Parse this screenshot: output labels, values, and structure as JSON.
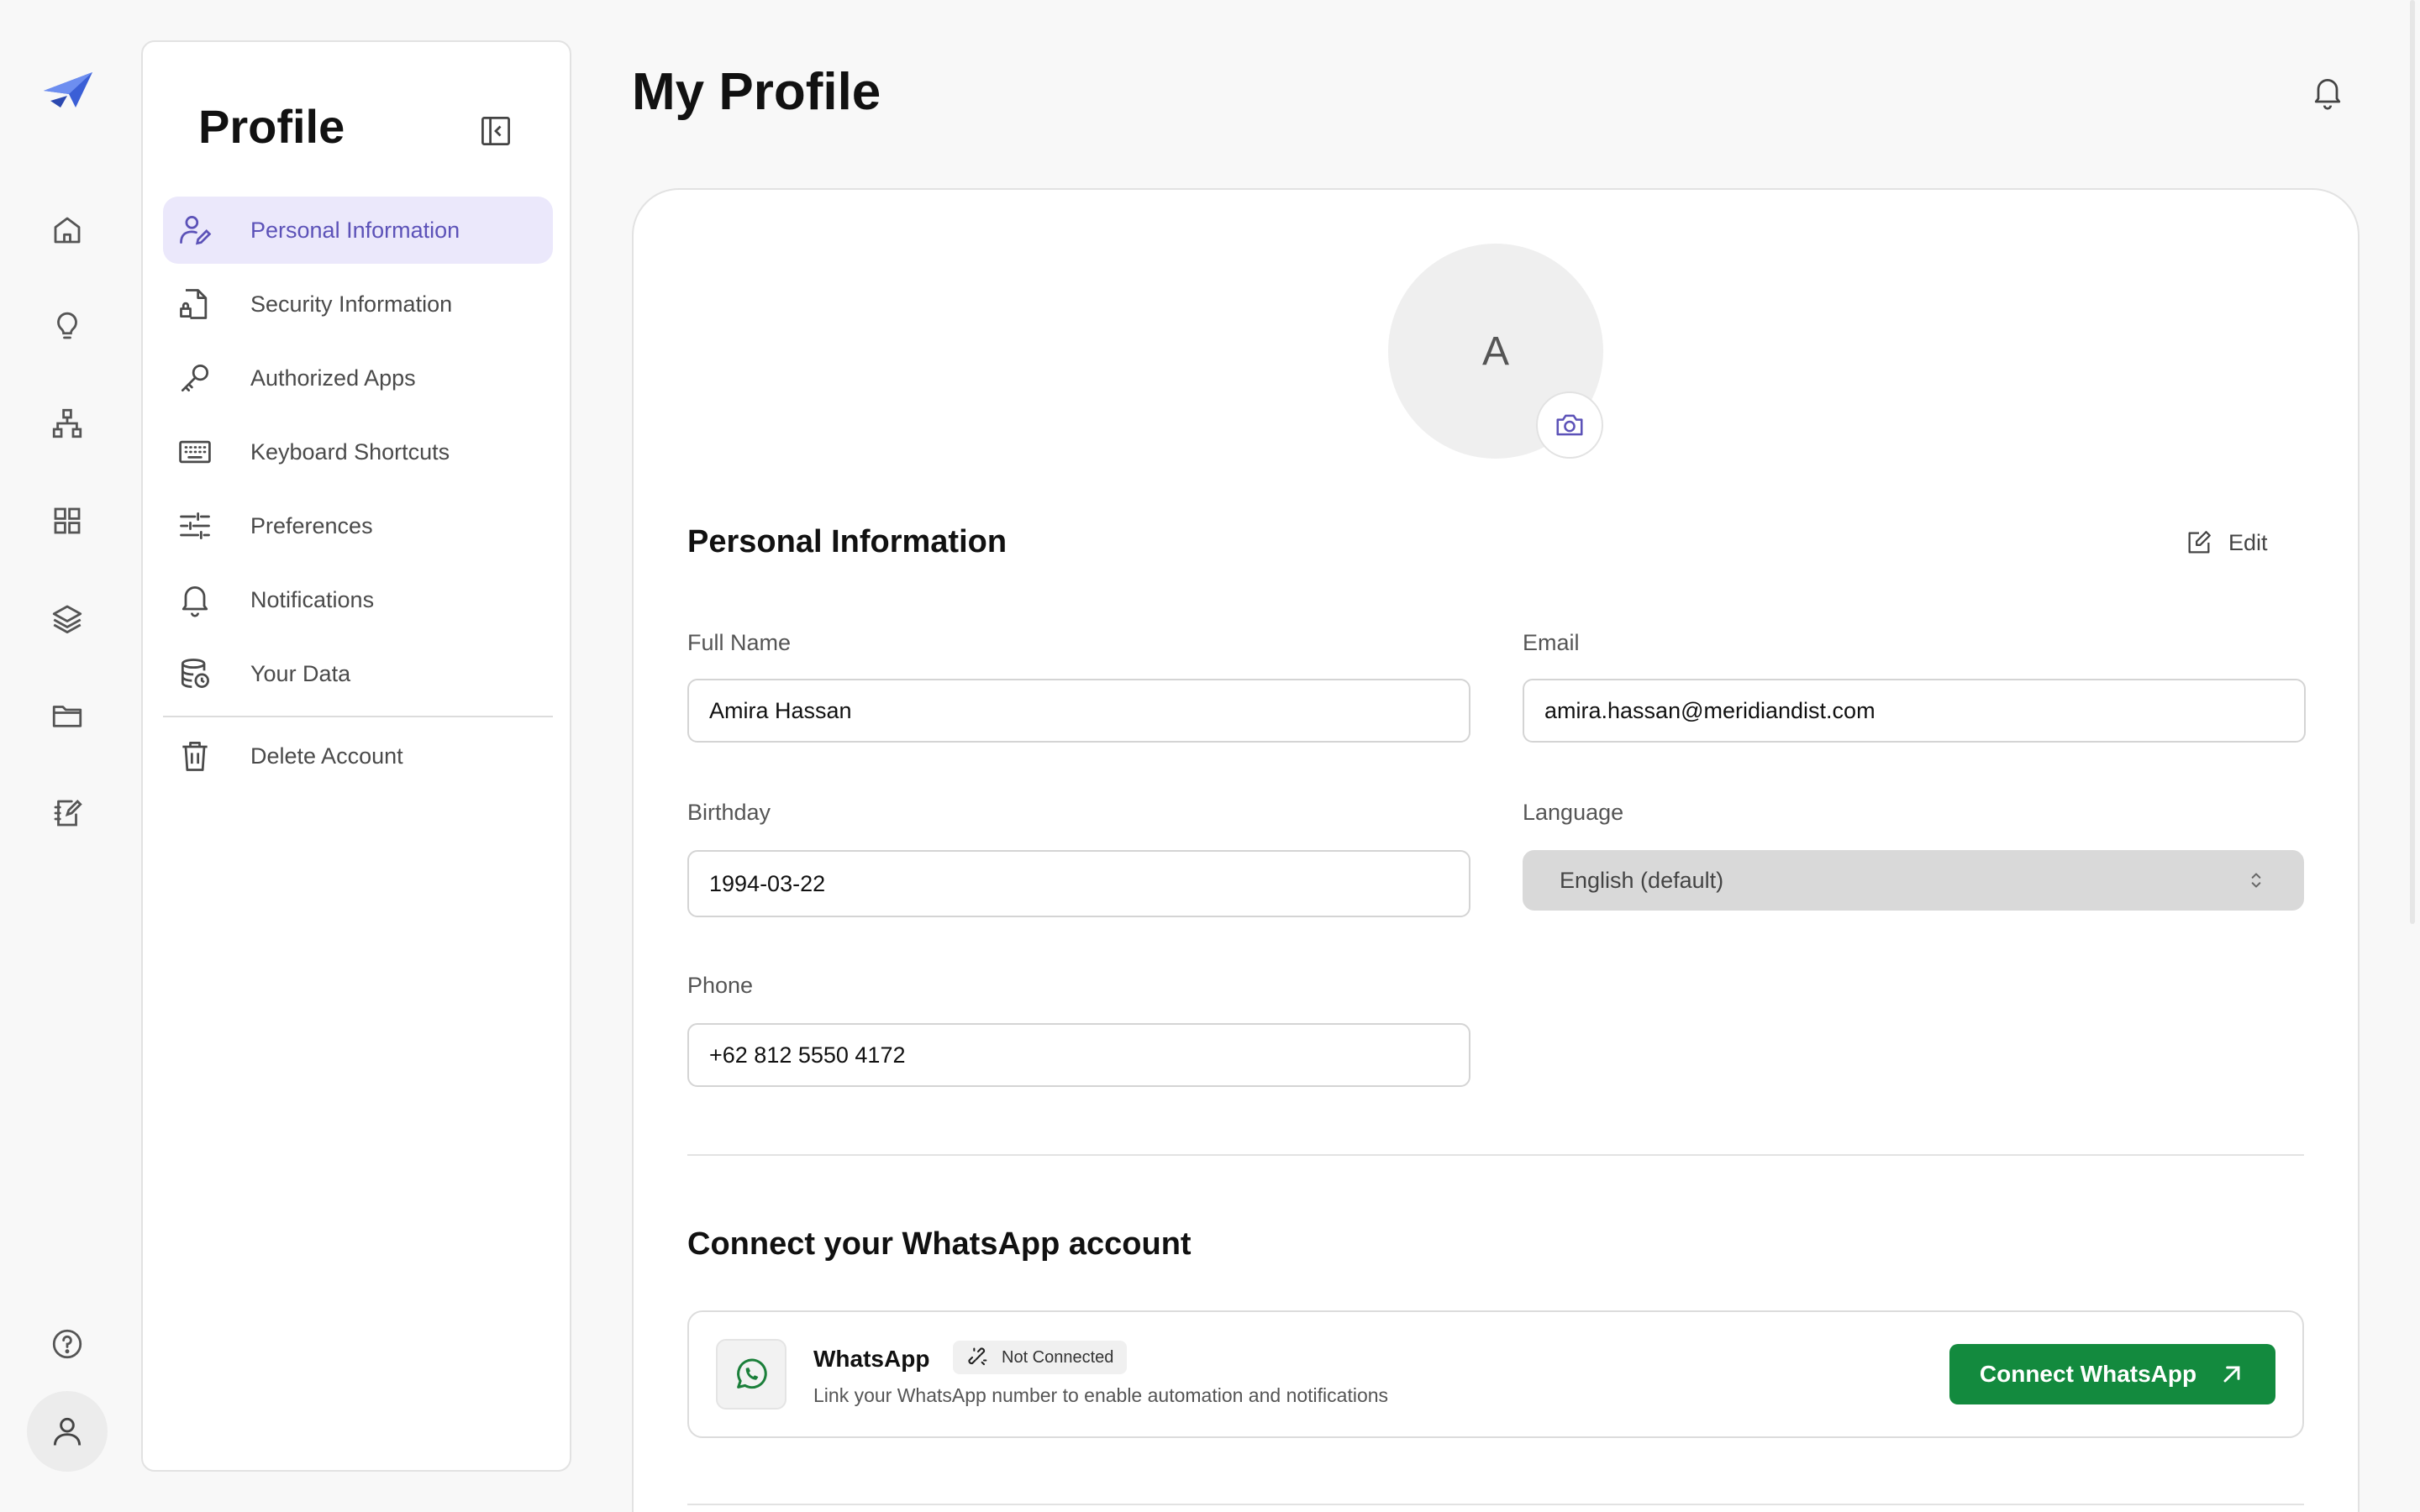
{
  "rail": {
    "items": [
      {
        "name": "home",
        "icon": "home-icon"
      },
      {
        "name": "ideas",
        "icon": "lightbulb-icon"
      },
      {
        "name": "structure",
        "icon": "hierarchy-icon"
      },
      {
        "name": "apps",
        "icon": "grid-icon"
      },
      {
        "name": "layers",
        "icon": "layers-icon"
      },
      {
        "name": "files",
        "icon": "folder-icon"
      },
      {
        "name": "notes",
        "icon": "notebook-edit-icon"
      }
    ],
    "help_icon": "help-circle-icon",
    "profile_icon": "user-icon"
  },
  "sidebar": {
    "title": "Profile",
    "items": [
      {
        "label": "Personal Information",
        "icon": "user-edit-icon",
        "active": true
      },
      {
        "label": "Security Information",
        "icon": "document-lock-icon"
      },
      {
        "label": "Authorized Apps",
        "icon": "key-icon"
      },
      {
        "label": "Keyboard Shortcuts",
        "icon": "keyboard-icon"
      },
      {
        "label": "Preferences",
        "icon": "sliders-icon"
      },
      {
        "label": "Notifications",
        "icon": "bell-icon"
      },
      {
        "label": "Your Data",
        "icon": "database-icon"
      }
    ],
    "danger_item": {
      "label": "Delete Account",
      "icon": "trash-icon"
    }
  },
  "header": {
    "title": "My Profile"
  },
  "profile": {
    "avatar_initial": "A",
    "section_title": "Personal Information",
    "edit_label": "Edit",
    "fields": {
      "full_name": {
        "label": "Full Name",
        "value": "Amira Hassan"
      },
      "email": {
        "label": "Email",
        "value": "amira.hassan@meridiandist.com"
      },
      "birthday": {
        "label": "Birthday",
        "value": "1994-03-22"
      },
      "language": {
        "label": "Language",
        "value": "English (default)"
      },
      "phone": {
        "label": "Phone",
        "value": "+62 812 5550 4172"
      }
    }
  },
  "whatsapp": {
    "section_title": "Connect your WhatsApp account",
    "name": "WhatsApp",
    "status": "Not Connected",
    "description": "Link your WhatsApp number to enable automation and notifications",
    "connect_label": "Connect WhatsApp"
  },
  "colors": {
    "accent": "#5c52b8",
    "active_bg": "#ebe8fb",
    "whatsapp_green": "#138a3e"
  }
}
